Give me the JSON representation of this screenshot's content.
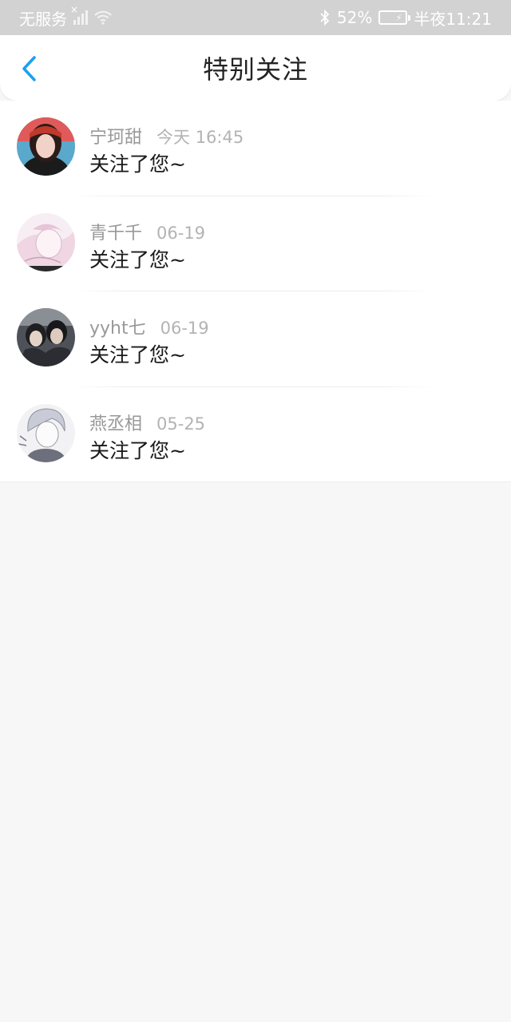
{
  "status_bar": {
    "carrier": "无服务",
    "battery_percent": "52%",
    "battery_level": 0.52,
    "time": "半夜11:21"
  },
  "header": {
    "title": "特别关注",
    "back_icon": "chevron-left-icon",
    "accent_color": "#1aa0f0"
  },
  "notifications": [
    {
      "name": "宁珂甜",
      "time": "今天 16:45",
      "message": "关注了您~"
    },
    {
      "name": "青千千",
      "time": "06-19",
      "message": "关注了您~"
    },
    {
      "name": "yyht七",
      "time": "06-19",
      "message": "关注了您~"
    },
    {
      "name": "燕丞相",
      "time": "05-25",
      "message": "关注了您~"
    }
  ]
}
